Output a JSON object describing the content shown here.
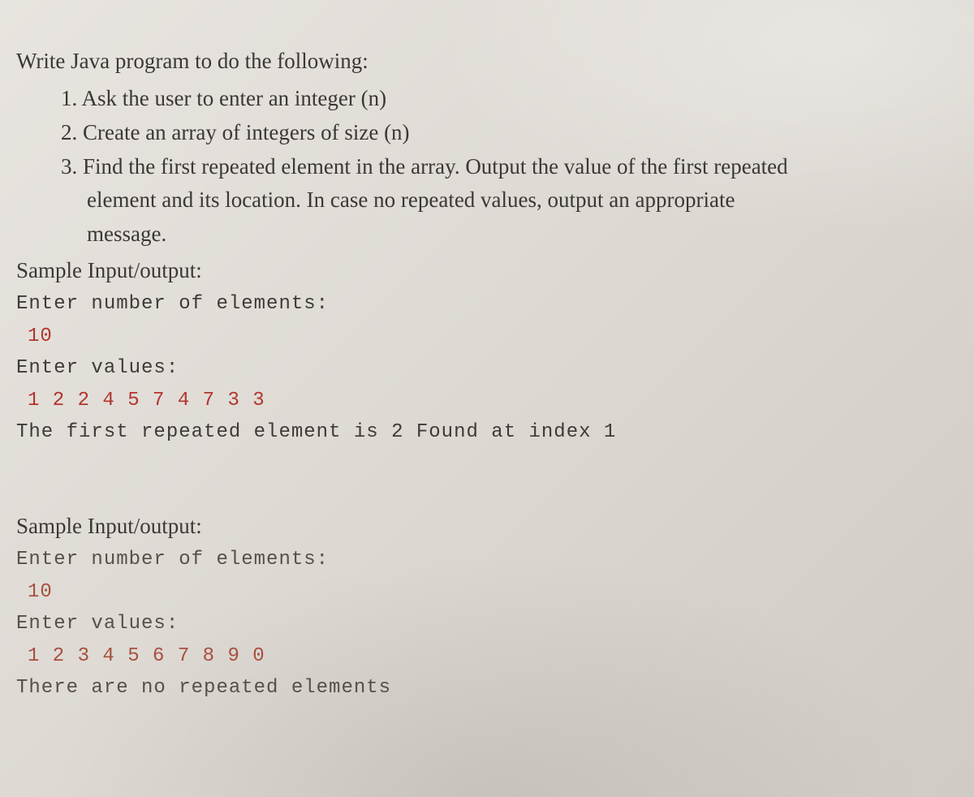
{
  "intro": "Write Java program to do the following:",
  "items": [
    "1. Ask the user to enter an integer (n)",
    "2. Create an array of integers of size (n)",
    "3. Find the first repeated element in the array. Output the value of the first repeated"
  ],
  "item3_cont": "element and its location. In case no repeated values, output an appropriate",
  "item3_cont2": "message.",
  "sample_label": "Sample Input/output:",
  "sample1": {
    "p1": "Enter number of elements:",
    "i1": "10",
    "p2": "Enter values:",
    "i2": "1 2 2 4 5 7 4 7 3 3",
    "out": "The first repeated element is 2 Found at index 1"
  },
  "sample2": {
    "p1": "Enter number of elements:",
    "i1": "10",
    "p2": "Enter values:",
    "i2": "1 2 3 4 5 6 7 8 9 0",
    "out": "There are no repeated elements"
  }
}
